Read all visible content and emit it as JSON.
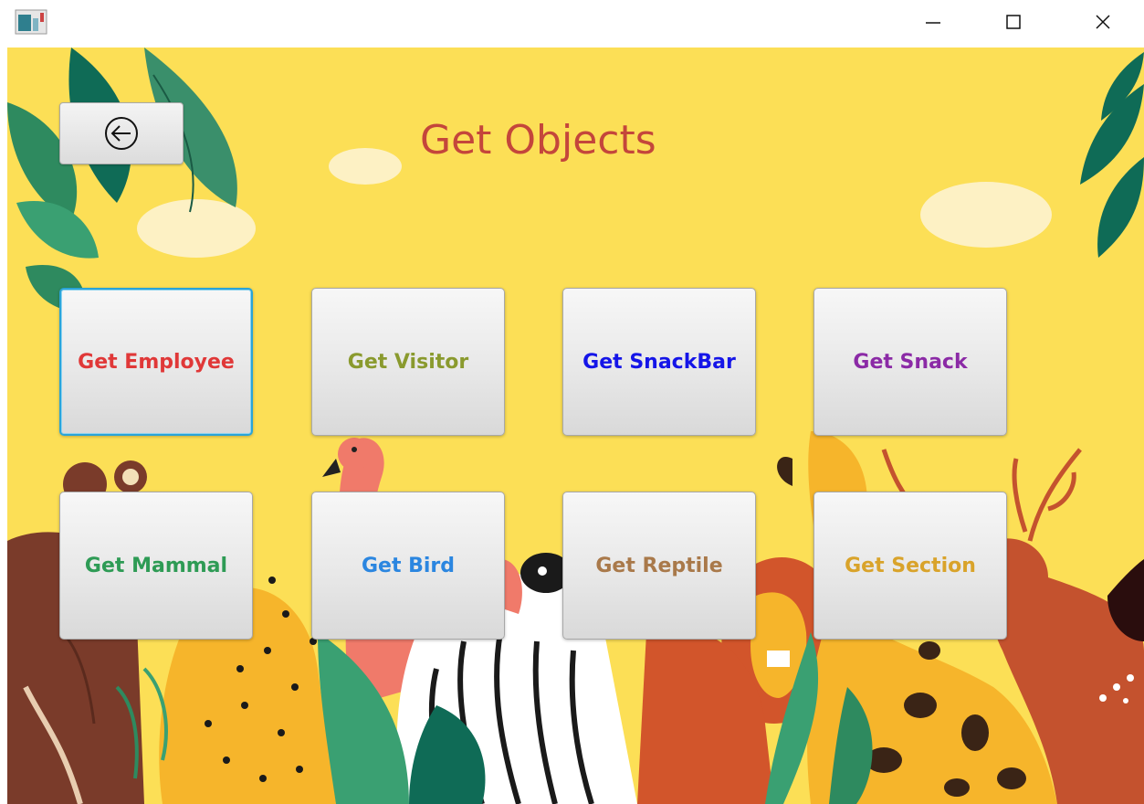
{
  "window": {
    "icons": {
      "app": "app-icon",
      "minimize": "minimize-icon",
      "maximize": "maximize-icon",
      "close": "close-icon"
    }
  },
  "header": {
    "title": "Get Objects",
    "back_icon": "back-arrow-icon"
  },
  "buttons": [
    {
      "label": "Get Employee",
      "color": "#e03838"
    },
    {
      "label": "Get Visitor",
      "color": "#8a9a2e"
    },
    {
      "label": "Get SnackBar",
      "color": "#1515e8"
    },
    {
      "label": "Get Snack",
      "color": "#8b2aa6"
    },
    {
      "label": "Get Mammal",
      "color": "#2e9b55"
    },
    {
      "label": "Get Bird",
      "color": "#2b86e0"
    },
    {
      "label": "Get Reptile",
      "color": "#a9794a"
    },
    {
      "label": "Get Section",
      "color": "#d9a32a"
    }
  ],
  "colors": {
    "background": "#fcdf56",
    "title": "#c4463b",
    "focus": "#2aa4d8"
  }
}
